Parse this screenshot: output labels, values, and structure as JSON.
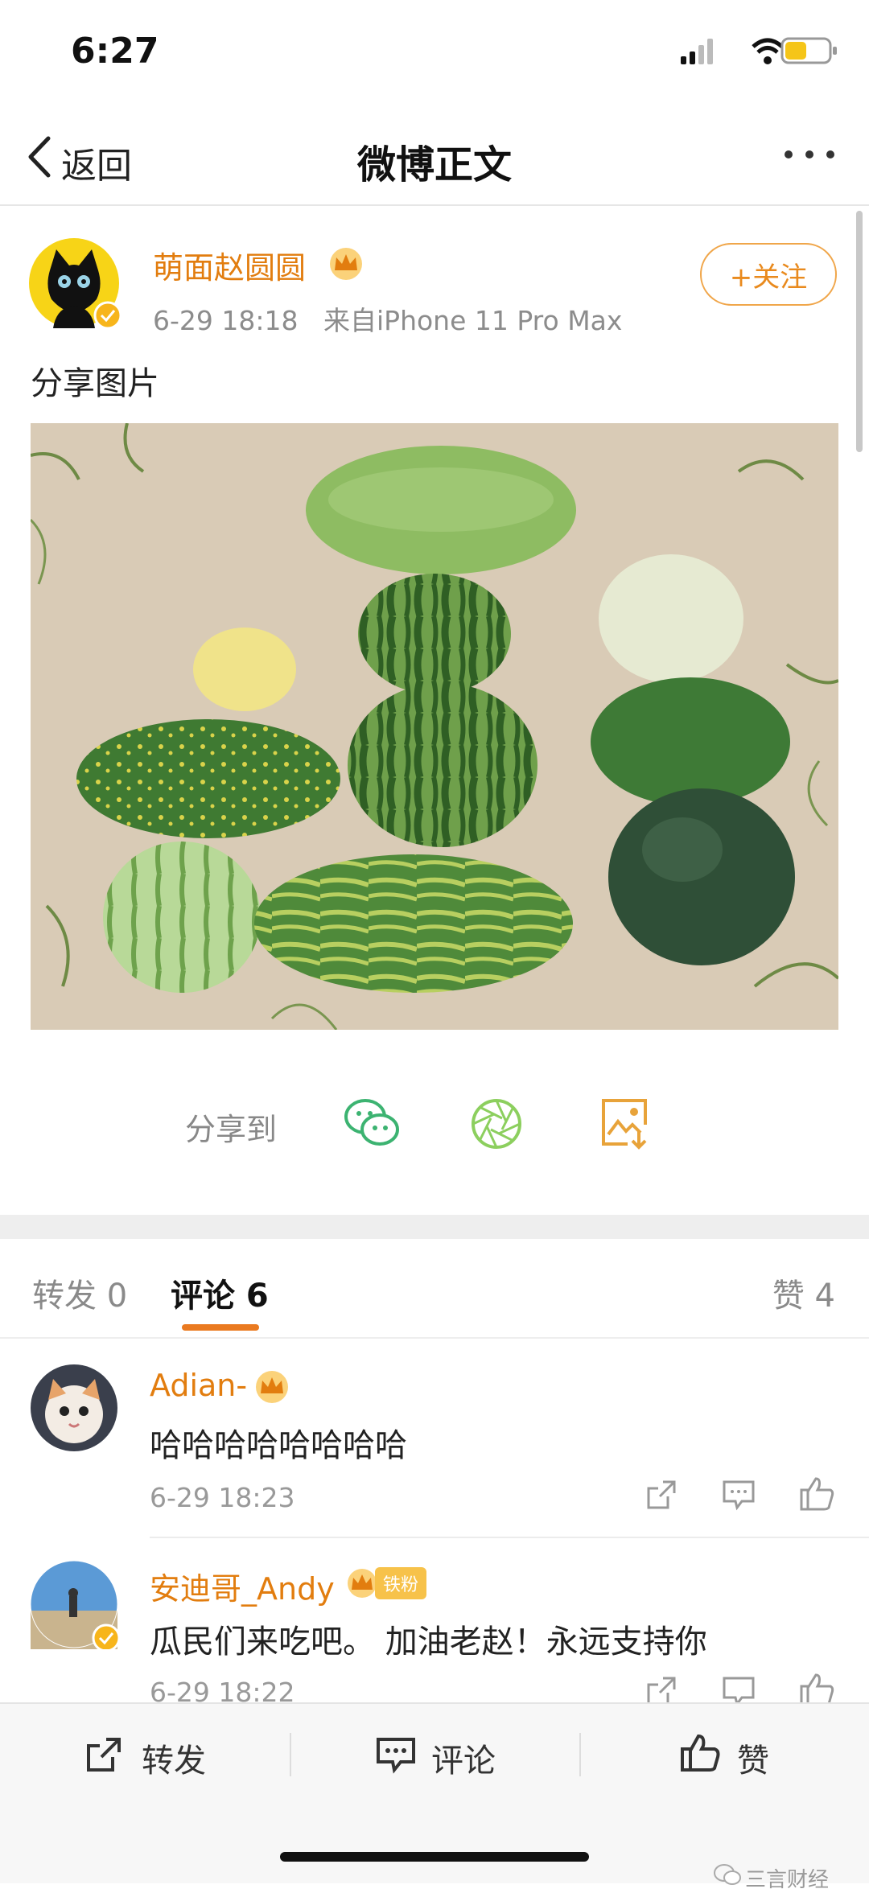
{
  "status_bar": {
    "time": "6:27"
  },
  "nav": {
    "back_label": "返回",
    "title": "微博正文"
  },
  "post": {
    "author": "萌面赵圆圆",
    "time": "6-29 18:18",
    "source": "来自iPhone 11 Pro Max",
    "follow_label": "+关注",
    "text": "分享图片"
  },
  "share": {
    "label": "分享到"
  },
  "tabs": {
    "repost": "转发 0",
    "comment": "评论 6",
    "like": "赞 4"
  },
  "comments": [
    {
      "name": "Adian-",
      "text": "哈哈哈哈哈哈哈哈",
      "time": "6-29 18:23"
    },
    {
      "name": "安迪哥_Andy",
      "badge": "铁粉",
      "text": "瓜民们来吃吧。 加油老赵！永远支持你",
      "time": "6-29 18:22"
    }
  ],
  "bottom_bar": {
    "repost": "转发",
    "comment": "评论",
    "like": "赞"
  },
  "watermark": "三言财经",
  "colors": {
    "accent_orange": "#e27d0f",
    "wechat_green": "#3cb371"
  },
  "icons": [
    "back-icon",
    "more-icon",
    "wechat-icon",
    "moments-icon",
    "save-image-icon",
    "share-icon",
    "comment-icon",
    "like-icon",
    "vip-crown-icon",
    "verified-icon"
  ]
}
